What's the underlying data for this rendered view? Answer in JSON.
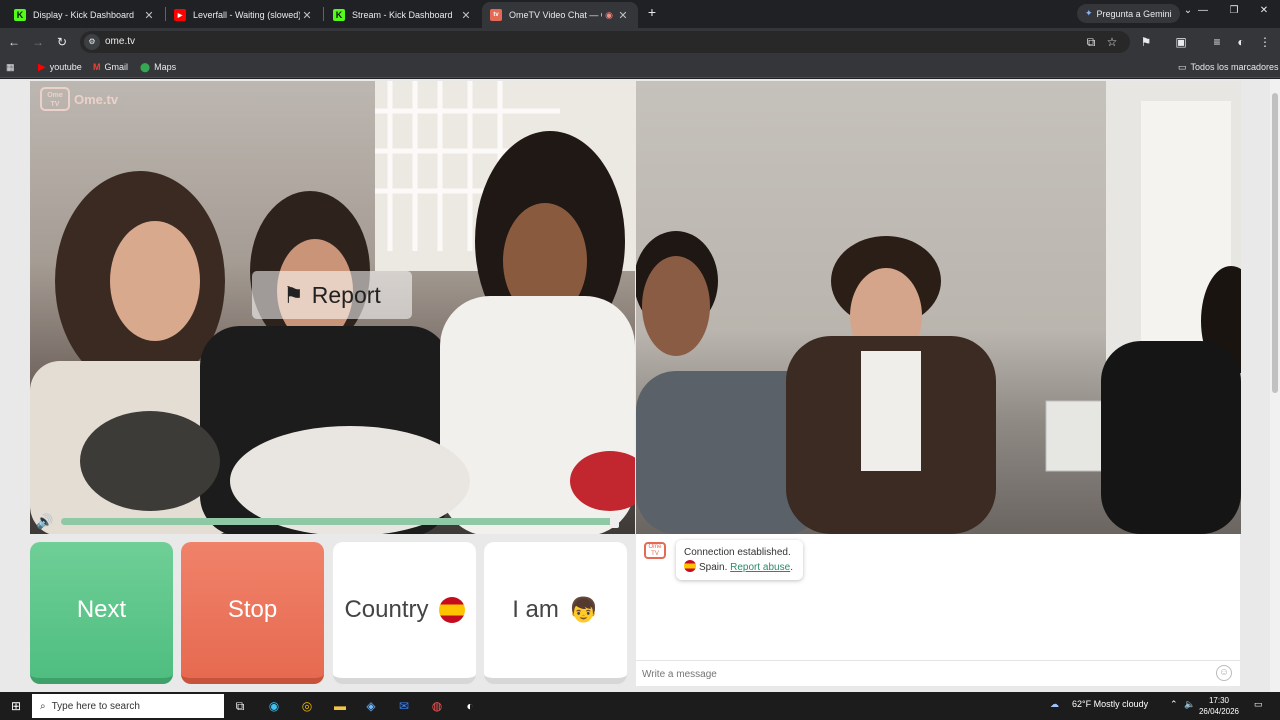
{
  "tabs": [
    {
      "title": "Display - Kick Dashboard",
      "favicon": "kick-icon",
      "active": false
    },
    {
      "title": "Leverfall - Waiting (slowed) - Yo",
      "favicon": "youtube-icon",
      "active": false
    },
    {
      "title": "Stream - Kick Dashboard",
      "favicon": "kick-icon",
      "active": false
    },
    {
      "title": "OmeTV Video Chat — Ome",
      "favicon": "ometv-icon",
      "active": true
    }
  ],
  "gemini_label": "Pregunta a Gemini",
  "address": {
    "url": "ome.tv"
  },
  "bookmarks": [
    {
      "label": "youtube",
      "icon": "youtube-icon"
    },
    {
      "label": "Gmail",
      "icon": "gmail-icon"
    },
    {
      "label": "Maps",
      "icon": "maps-icon"
    }
  ],
  "all_bookmarks_label": "Todos los marcadores",
  "site": {
    "logo_text": "Ome.tv",
    "logo_badge": "Ome TV",
    "report_label": "Report",
    "volume_level": 0.99,
    "buttons": {
      "next": "Next",
      "stop": "Stop",
      "country": "Country",
      "iam": "I am"
    },
    "chat": {
      "badge": "Ome TV",
      "status": "Connection established.",
      "country": "Spain.",
      "report_link": "Report abuse",
      "report_suffix": ".",
      "message_placeholder": "Write a message"
    }
  },
  "taskbar": {
    "search_placeholder": "Type here to search",
    "weather": "62°F  Mostly cloudy",
    "time": "17:30",
    "date": "26/04/2026"
  },
  "colors": {
    "next": "#5cc68b",
    "stop": "#ea7459",
    "kick": "#53fc18",
    "youtube": "#ff0000"
  }
}
